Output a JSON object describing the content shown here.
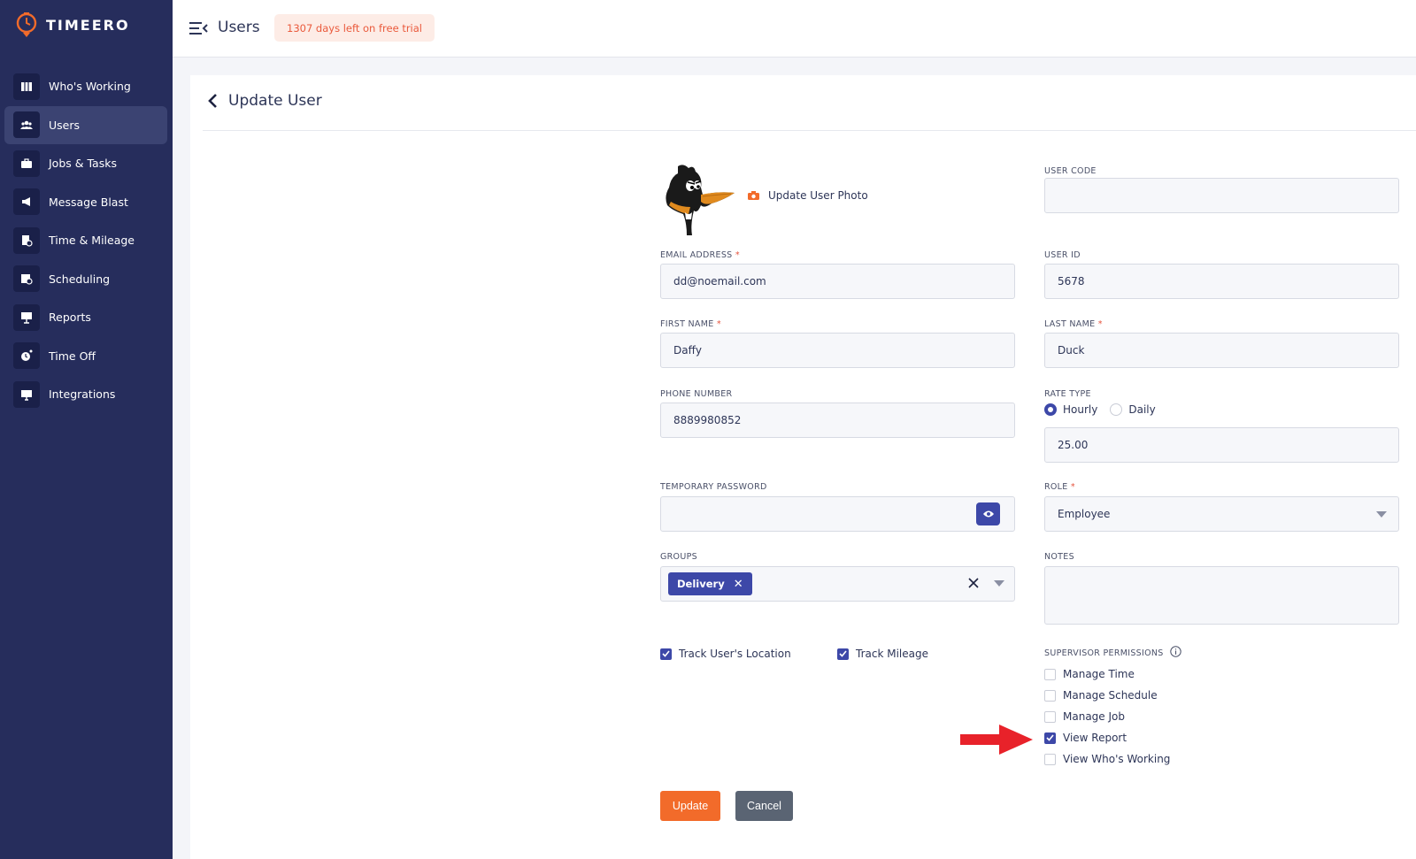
{
  "brand": {
    "name": "TIMEERO"
  },
  "sidebar": {
    "items": [
      {
        "label": "Who's Working",
        "icon": "map-icon",
        "active": false
      },
      {
        "label": "Users",
        "icon": "users-icon",
        "active": true
      },
      {
        "label": "Jobs & Tasks",
        "icon": "briefcase-icon",
        "active": false
      },
      {
        "label": "Message Blast",
        "icon": "megaphone-icon",
        "active": false
      },
      {
        "label": "Time & Mileage",
        "icon": "timesheet-icon",
        "active": false
      },
      {
        "label": "Scheduling",
        "icon": "calendar-clock-icon",
        "active": false
      },
      {
        "label": "Reports",
        "icon": "presentation-icon",
        "active": false
      },
      {
        "label": "Time Off",
        "icon": "time-off-icon",
        "active": false
      },
      {
        "label": "Integrations",
        "icon": "monitor-icon",
        "active": false
      }
    ]
  },
  "topbar": {
    "title": "Users",
    "trial_badge": "1307 days left on free trial"
  },
  "page": {
    "title": "Update User"
  },
  "form": {
    "update_photo_label": "Update User Photo",
    "user_code": {
      "label": "USER CODE",
      "value": ""
    },
    "email": {
      "label": "EMAIL ADDRESS",
      "required_mark": "*",
      "value": "dd@noemail.com"
    },
    "user_id": {
      "label": "USER ID",
      "value": "5678"
    },
    "first_name": {
      "label": "FIRST NAME",
      "required_mark": "*",
      "value": "Daffy"
    },
    "last_name": {
      "label": "LAST NAME",
      "required_mark": "*",
      "value": "Duck"
    },
    "phone": {
      "label": "PHONE NUMBER",
      "value": "8889980852"
    },
    "rate_type": {
      "label": "RATE TYPE",
      "options": [
        "Hourly",
        "Daily"
      ],
      "selected": "Hourly",
      "value": "25.00"
    },
    "temp_password": {
      "label": "TEMPORARY PASSWORD",
      "value": ""
    },
    "role": {
      "label": "ROLE",
      "required_mark": "*",
      "value": "Employee"
    },
    "groups": {
      "label": "GROUPS",
      "tags": [
        "Delivery"
      ]
    },
    "notes": {
      "label": "NOTES",
      "value": ""
    },
    "track_location": {
      "label": "Track User's Location",
      "checked": true
    },
    "track_mileage": {
      "label": "Track Mileage",
      "checked": true
    },
    "supervisor_permissions": {
      "label": "SUPERVISOR PERMISSIONS",
      "items": [
        {
          "label": "Manage Time",
          "checked": false
        },
        {
          "label": "Manage Schedule",
          "checked": false
        },
        {
          "label": "Manage Job",
          "checked": false
        },
        {
          "label": "View Report",
          "checked": true
        },
        {
          "label": "View Who's Working",
          "checked": false
        }
      ]
    },
    "update_button": "Update",
    "cancel_button": "Cancel"
  },
  "colors": {
    "sidebar_bg": "#262d5c",
    "accent": "#3d48a8",
    "primary_button": "#f26b2a",
    "secondary_button": "#5a6473",
    "trial_text": "#ea5a3c",
    "annotation_arrow": "#e8222a"
  }
}
